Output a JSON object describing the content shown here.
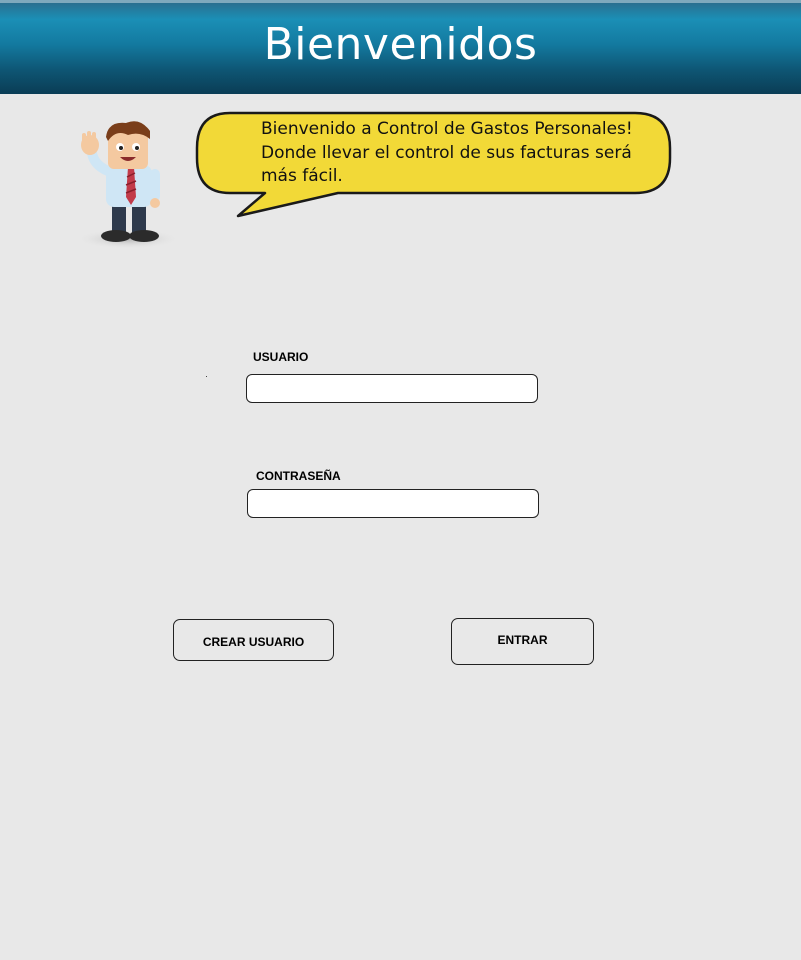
{
  "header": {
    "title": "Bienvenidos"
  },
  "welcome": {
    "mascot_icon": "waving-businessman-icon",
    "message": "Bienvenido a Control de Gastos Personales!\nDonde llevar el control de sus facturas será\nmás fácil.",
    "bubble_color": "#f2d937"
  },
  "login": {
    "username_label": "USUARIO",
    "username_value": "",
    "password_label": "CONTRASEÑA",
    "password_value": "",
    "create_user_label": "CREAR USUARIO",
    "enter_label": "ENTRAR"
  },
  "colors": {
    "header_top": "#1b8fb6",
    "header_bottom": "#0a3d55",
    "background": "#e8e8e8"
  }
}
